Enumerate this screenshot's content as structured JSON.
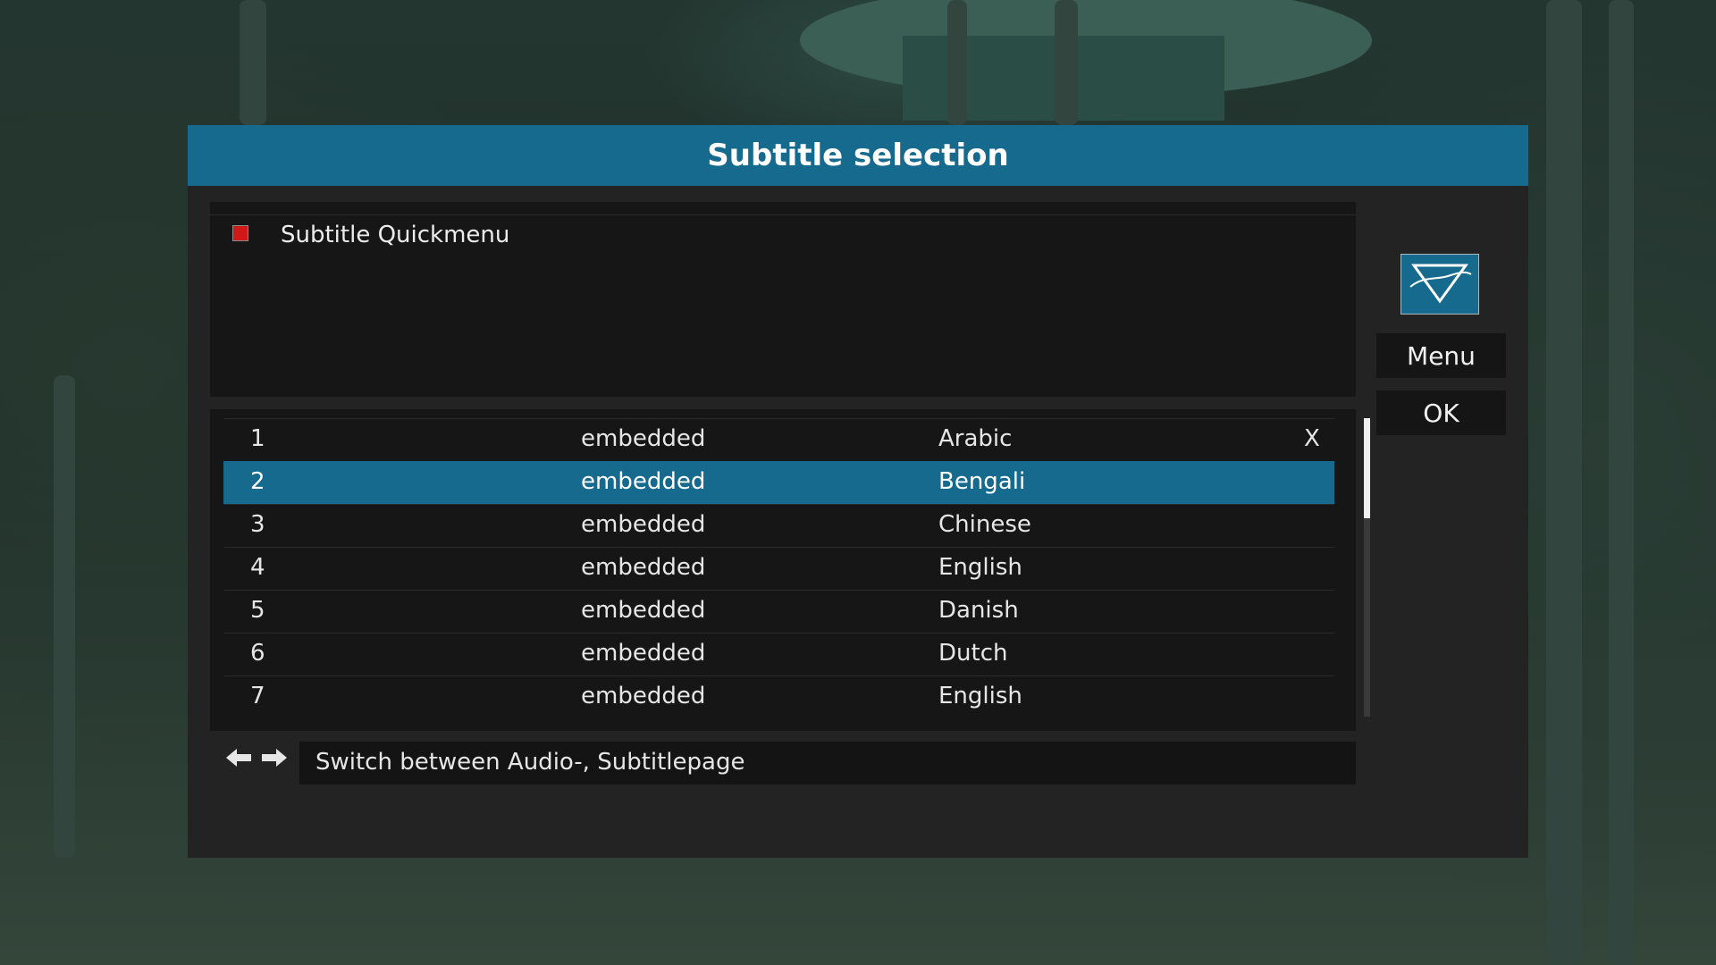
{
  "dialog": {
    "title": "Subtitle selection"
  },
  "quickmenu": {
    "label": "Subtitle Quickmenu",
    "key_color": "#d01818"
  },
  "subtitles": [
    {
      "index": "1",
      "type": "embedded",
      "language": "Arabic",
      "mark": "X"
    },
    {
      "index": "2",
      "type": "embedded",
      "language": "Bengali",
      "mark": ""
    },
    {
      "index": "3",
      "type": "embedded",
      "language": "Chinese",
      "mark": ""
    },
    {
      "index": "4",
      "type": "embedded",
      "language": "English",
      "mark": ""
    },
    {
      "index": "5",
      "type": "embedded",
      "language": "Danish",
      "mark": ""
    },
    {
      "index": "6",
      "type": "embedded",
      "language": "Dutch",
      "mark": ""
    },
    {
      "index": "7",
      "type": "embedded",
      "language": "English",
      "mark": ""
    }
  ],
  "selected_index": 1,
  "hint": {
    "text": "Switch between Audio-, Subtitlepage"
  },
  "side": {
    "menu_label": "Menu",
    "ok_label": "OK"
  },
  "colors": {
    "accent": "#156a8e",
    "dialog_bg": "#232323",
    "panel_bg": "#161616"
  }
}
